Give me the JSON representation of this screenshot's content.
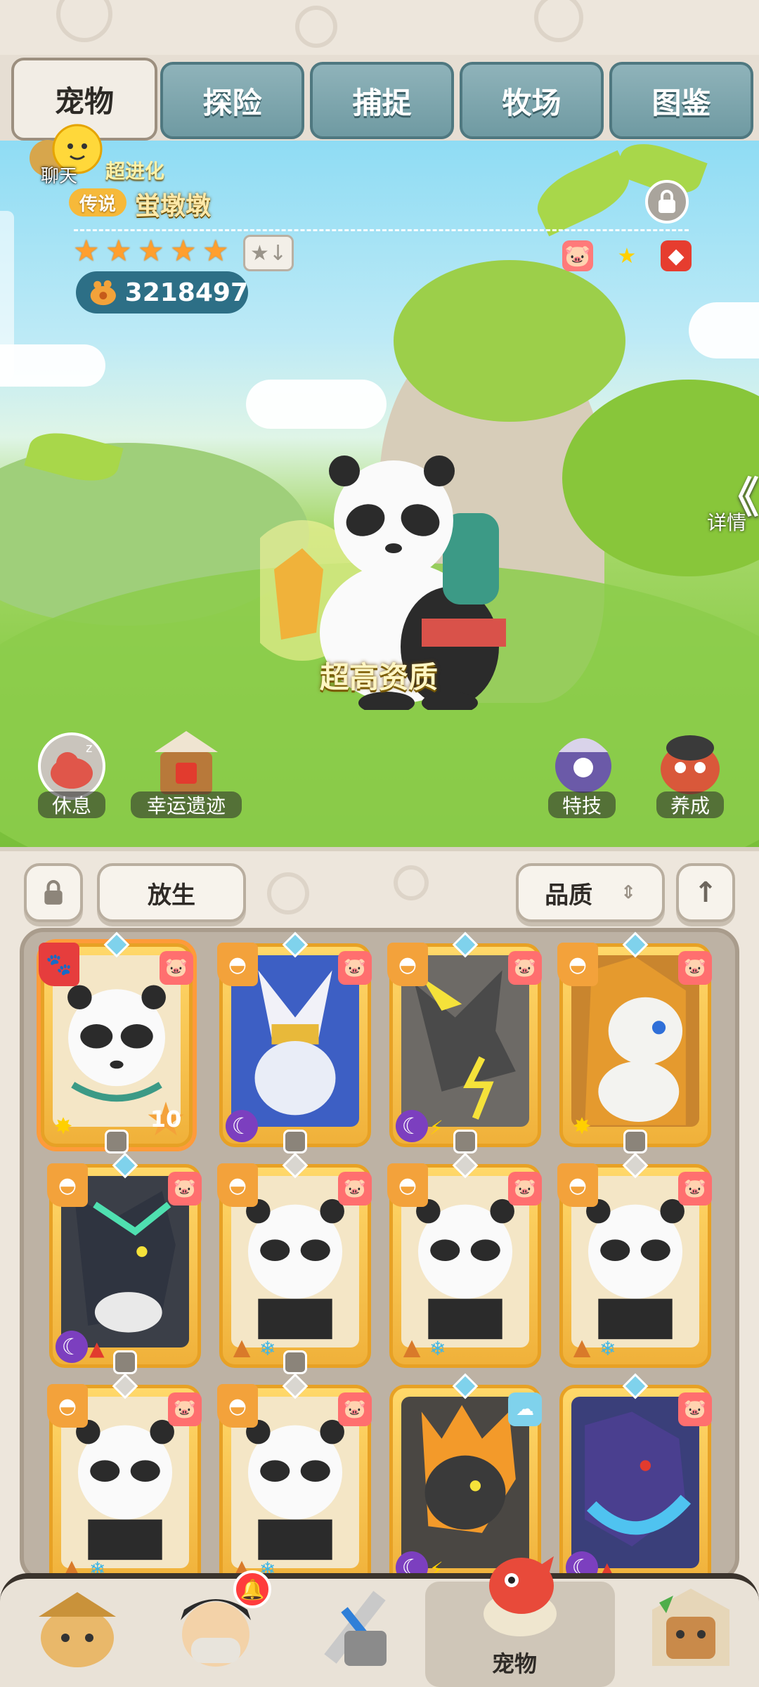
{
  "tabs": [
    {
      "label": "宠物",
      "active": true
    },
    {
      "label": "探险",
      "active": false
    },
    {
      "label": "捕捉",
      "active": false
    },
    {
      "label": "牧场",
      "active": false
    },
    {
      "label": "图鉴",
      "active": false
    }
  ],
  "chat": {
    "label": "聊天"
  },
  "pet": {
    "evolve_label": "超进化",
    "rarity": "传说",
    "name": "蛍墩墩",
    "stars": 5,
    "power": "3218497",
    "quality_text": "超高资质"
  },
  "detail": {
    "arrow": "《",
    "label": "详情"
  },
  "scene_actions": {
    "rest": "休息",
    "ruins": "幸运遗迹",
    "skill": "特技",
    "train": "养成"
  },
  "toolbar": {
    "release_label": "放生",
    "sort_label": "品质",
    "sort_icon": "⇕",
    "up_icon": "↑"
  },
  "grid": {
    "level_badge": "10"
  },
  "nav": {
    "active_label": "宠物",
    "notification": "🔔"
  },
  "colors": {
    "tab_blue": "#7fa8b0",
    "card_gold": "#f6c24e",
    "rarity_orange": "#f6b93a",
    "power_bg": "#2d6f86"
  }
}
